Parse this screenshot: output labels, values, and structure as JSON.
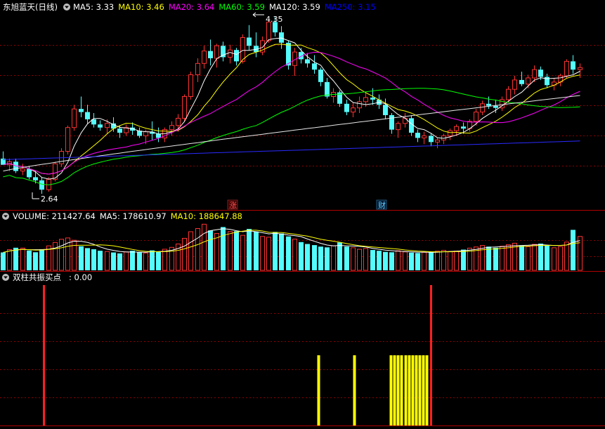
{
  "price_panel": {
    "title": "东旭蓝天(日线)",
    "ma_labels": [
      {
        "key": "ma5",
        "text": "MA5: 3.33",
        "color": "#ffffff"
      },
      {
        "key": "ma10",
        "text": "MA10: 3.46",
        "color": "#ffff00"
      },
      {
        "key": "ma20",
        "text": "MA20: 3.64",
        "color": "#ff00ff"
      },
      {
        "key": "ma60",
        "text": "MA60: 3.59",
        "color": "#00ff00"
      },
      {
        "key": "ma120",
        "text": "MA120: 3.59",
        "color": "#ffffff"
      },
      {
        "key": "ma250",
        "text": "MA250: 3.15",
        "color": "#0000ff"
      }
    ],
    "high_label": "4.35",
    "low_label": "2.64",
    "markers": [
      {
        "text": "涨",
        "color": "#ff5555"
      },
      {
        "text": "财",
        "color": "#66ccff"
      }
    ]
  },
  "volume_panel": {
    "labels": [
      {
        "key": "volume",
        "text": "VOLUME: 211427.64",
        "color": "#ffffff"
      },
      {
        "key": "vol_ma5",
        "text": "MA5: 178610.97",
        "color": "#ffffff"
      },
      {
        "key": "vol_ma10",
        "text": "MA10: 188647.88",
        "color": "#ffff00"
      }
    ]
  },
  "indicator_panel": {
    "name": "双柱共振买点",
    "value": ": 0.00"
  },
  "colors": {
    "up": "#ff3232",
    "down": "#54fcfc",
    "grid": "#8b0000",
    "separator": "#b00000",
    "signal_red": "#ff2020",
    "signal_yellow": "#ffff00"
  },
  "chart_data": [
    {
      "type": "candlestick",
      "title": "东旭蓝天(日线)",
      "price_range": [
        2.64,
        4.35
      ],
      "ohlc": [
        [
          2.98,
          3.05,
          2.92,
          2.92
        ],
        [
          2.92,
          2.98,
          2.86,
          2.95
        ],
        [
          2.95,
          2.98,
          2.84,
          2.86
        ],
        [
          2.86,
          2.93,
          2.82,
          2.88
        ],
        [
          2.88,
          2.91,
          2.78,
          2.8
        ],
        [
          2.8,
          2.86,
          2.74,
          2.77
        ],
        [
          2.77,
          2.8,
          2.64,
          2.68
        ],
        [
          2.68,
          2.8,
          2.66,
          2.78
        ],
        [
          2.78,
          2.95,
          2.76,
          2.93
        ],
        [
          2.93,
          3.08,
          2.9,
          3.05
        ],
        [
          3.05,
          3.3,
          3.02,
          3.28
        ],
        [
          3.28,
          3.5,
          3.25,
          3.46
        ],
        [
          3.46,
          3.58,
          3.38,
          3.43
        ],
        [
          3.43,
          3.5,
          3.32,
          3.36
        ],
        [
          3.36,
          3.42,
          3.28,
          3.31
        ],
        [
          3.31,
          3.35,
          3.25,
          3.28
        ],
        [
          3.28,
          3.36,
          3.22,
          3.32
        ],
        [
          3.32,
          3.38,
          3.24,
          3.27
        ],
        [
          3.27,
          3.3,
          3.18,
          3.23
        ],
        [
          3.23,
          3.31,
          3.2,
          3.28
        ],
        [
          3.28,
          3.33,
          3.21,
          3.25
        ],
        [
          3.25,
          3.28,
          3.18,
          3.2
        ],
        [
          3.2,
          3.26,
          3.12,
          3.24
        ],
        [
          3.24,
          3.34,
          3.16,
          3.22
        ],
        [
          3.22,
          3.28,
          3.14,
          3.18
        ],
        [
          3.18,
          3.28,
          3.14,
          3.26
        ],
        [
          3.26,
          3.34,
          3.2,
          3.3
        ],
        [
          3.3,
          3.41,
          3.24,
          3.37
        ],
        [
          3.37,
          3.6,
          3.34,
          3.58
        ],
        [
          3.58,
          3.82,
          3.55,
          3.79
        ],
        [
          3.79,
          3.95,
          3.72,
          3.9
        ],
        [
          3.9,
          4.07,
          3.85,
          4.02
        ],
        [
          4.02,
          4.13,
          3.88,
          3.95
        ],
        [
          3.95,
          4.09,
          3.86,
          4.07
        ],
        [
          4.07,
          4.11,
          3.92,
          3.96
        ],
        [
          3.96,
          4.08,
          3.9,
          4.03
        ],
        [
          4.03,
          4.05,
          3.88,
          3.92
        ],
        [
          3.92,
          4.18,
          3.9,
          4.15
        ],
        [
          4.15,
          4.27,
          4.03,
          4.07
        ],
        [
          4.07,
          4.2,
          3.96,
          4.01
        ],
        [
          4.01,
          4.16,
          3.98,
          4.12
        ],
        [
          4.12,
          4.33,
          4.1,
          4.3
        ],
        [
          4.3,
          4.35,
          4.16,
          4.2
        ],
        [
          4.2,
          4.26,
          4.04,
          4.1
        ],
        [
          4.1,
          4.12,
          3.84,
          3.88
        ],
        [
          3.88,
          4.05,
          3.78,
          4.01
        ],
        [
          4.01,
          4.05,
          3.9,
          3.94
        ],
        [
          3.94,
          4.0,
          3.86,
          3.9
        ],
        [
          3.9,
          3.98,
          3.8,
          3.84
        ],
        [
          3.84,
          3.86,
          3.68,
          3.72
        ],
        [
          3.72,
          3.76,
          3.56,
          3.58
        ],
        [
          3.58,
          3.66,
          3.52,
          3.62
        ],
        [
          3.62,
          3.64,
          3.48,
          3.51
        ],
        [
          3.51,
          3.55,
          3.4,
          3.43
        ],
        [
          3.43,
          3.52,
          3.38,
          3.47
        ],
        [
          3.47,
          3.58,
          3.42,
          3.53
        ],
        [
          3.53,
          3.62,
          3.48,
          3.57
        ],
        [
          3.57,
          3.66,
          3.5,
          3.55
        ],
        [
          3.55,
          3.6,
          3.46,
          3.5
        ],
        [
          3.5,
          3.56,
          3.36,
          3.4
        ],
        [
          3.4,
          3.42,
          3.22,
          3.26
        ],
        [
          3.26,
          3.34,
          3.18,
          3.32
        ],
        [
          3.32,
          3.42,
          3.28,
          3.37
        ],
        [
          3.37,
          3.4,
          3.2,
          3.23
        ],
        [
          3.23,
          3.26,
          3.14,
          3.18
        ],
        [
          3.18,
          3.24,
          3.12,
          3.2
        ],
        [
          3.2,
          3.22,
          3.1,
          3.14
        ],
        [
          3.14,
          3.18,
          3.08,
          3.16
        ],
        [
          3.16,
          3.22,
          3.12,
          3.2
        ],
        [
          3.2,
          3.27,
          3.16,
          3.25
        ],
        [
          3.25,
          3.31,
          3.2,
          3.29
        ],
        [
          3.29,
          3.33,
          3.22,
          3.27
        ],
        [
          3.27,
          3.36,
          3.24,
          3.34
        ],
        [
          3.34,
          3.46,
          3.3,
          3.43
        ],
        [
          3.43,
          3.54,
          3.4,
          3.51
        ],
        [
          3.51,
          3.58,
          3.46,
          3.49
        ],
        [
          3.49,
          3.55,
          3.42,
          3.47
        ],
        [
          3.47,
          3.58,
          3.44,
          3.55
        ],
        [
          3.55,
          3.68,
          3.52,
          3.65
        ],
        [
          3.65,
          3.78,
          3.6,
          3.74
        ],
        [
          3.74,
          3.82,
          3.68,
          3.7
        ],
        [
          3.7,
          3.79,
          3.66,
          3.76
        ],
        [
          3.76,
          3.88,
          3.72,
          3.84
        ],
        [
          3.84,
          3.87,
          3.74,
          3.77
        ],
        [
          3.77,
          3.8,
          3.66,
          3.69
        ],
        [
          3.69,
          3.76,
          3.64,
          3.72
        ],
        [
          3.72,
          3.8,
          3.68,
          3.78
        ],
        [
          3.78,
          3.94,
          3.76,
          3.92
        ],
        [
          3.92,
          3.98,
          3.8,
          3.84
        ],
        [
          3.84,
          3.9,
          3.76,
          3.86
        ]
      ],
      "ma_values": {
        "ma5": 3.33,
        "ma10": 3.46,
        "ma20": 3.64,
        "ma60": 3.59,
        "ma120": 3.59,
        "ma250": 3.15
      }
    },
    {
      "type": "bar",
      "title": "VOLUME",
      "values": [
        95,
        110,
        120,
        118,
        105,
        96,
        112,
        130,
        148,
        165,
        172,
        160,
        128,
        118,
        112,
        104,
        100,
        95,
        90,
        98,
        104,
        96,
        92,
        106,
        100,
        112,
        122,
        140,
        170,
        205,
        222,
        245,
        212,
        196,
        230,
        206,
        208,
        186,
        220,
        206,
        180,
        176,
        204,
        196,
        180,
        166,
        150,
        140,
        134,
        126,
        122,
        130,
        148,
        126,
        120,
        112,
        116,
        108,
        104,
        98,
        96,
        104,
        98,
        94,
        92,
        96,
        98,
        102,
        106,
        100,
        102,
        110,
        118,
        124,
        132,
        126,
        120,
        128,
        136,
        144,
        132,
        126,
        138,
        142,
        134,
        120,
        126,
        150,
        215,
        180
      ],
      "summary": {
        "volume": 211427.64,
        "ma5": 178610.97,
        "ma10": 188647.88
      }
    },
    {
      "type": "bar",
      "title": "双柱共振买点",
      "red_signal_bars": [
        10,
        117
      ],
      "yellow_signal_bars": [
        86,
        96,
        106,
        107,
        108,
        109,
        110,
        111,
        112,
        113,
        114,
        115,
        116
      ]
    }
  ]
}
